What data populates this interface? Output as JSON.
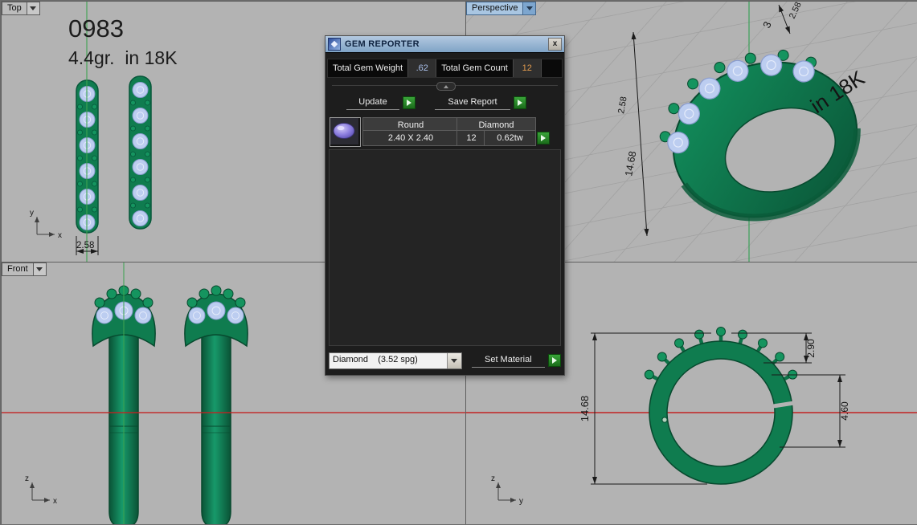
{
  "colors": {
    "ring_green": "#0f7c4f",
    "ring_green_dark": "#07492e",
    "gem_blue": "#bccdf0",
    "axis_green": "#3fa352",
    "axis_red": "#c22222",
    "go_button_green": "#2f8f2f",
    "titlebar_blue": "#7fa3c6",
    "viewport_gray": "#b3b3b3"
  },
  "viewports": {
    "top": {
      "label": "Top",
      "sku": "0983",
      "weight_line": "4.4gr.  in 18K",
      "dim_width": "2.58",
      "axis_v": "y",
      "axis_h": "x"
    },
    "front": {
      "label": "Front",
      "axis_v": "z",
      "axis_h": "x"
    },
    "perspective": {
      "label": "Perspective",
      "dim_height": "14.68",
      "dim_left_upper": "2.58",
      "dim_top": "2.58",
      "sku_partial": "3",
      "karat_text": "in 18K"
    },
    "right": {
      "dim_height": "14.68",
      "dim_prong": "2.90",
      "dim_band": "4.60",
      "axis_v": "z",
      "axis_h": "y"
    }
  },
  "gem_reporter": {
    "title": "GEM REPORTER",
    "close": "x",
    "total_weight_label": "Total Gem Weight",
    "total_weight_value": ".62",
    "total_count_label": "Total Gem Count",
    "total_count_value": "12",
    "update_label": "Update",
    "save_report_label": "Save Report",
    "table": {
      "shape": "Round",
      "material": "Diamond",
      "size": "2.40 X 2.40",
      "count": "12",
      "carat": "0.62tw"
    },
    "material_select": "Diamond    (3.52 spg)",
    "set_material_label": "Set Material"
  }
}
